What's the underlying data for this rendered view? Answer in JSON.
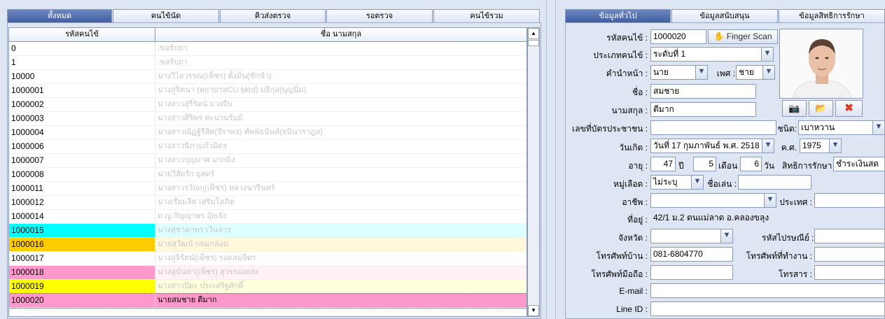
{
  "left_tabs": [
    "ทั้งหมด",
    "คนไข้นัด",
    "คิวส่งตรวจ",
    "รอตรวจ",
    "คนไข้รวม"
  ],
  "right_tabs": [
    "ข้อมูลทั่วไป",
    "ข้อมูลสนับสนุน",
    "ข้อมูลสิทธิการรักษา"
  ],
  "table": {
    "headers": [
      "รหัสคนไข้",
      "ชื่อ นามสกุล"
    ],
    "rows": [
      {
        "id": "0",
        "name": ".ขอรับยา",
        "color": ""
      },
      {
        "id": "1",
        "name": ".ขอรับยา",
        "color": ""
      },
      {
        "id": "10000",
        "name": "นางวิไลวรรณ(เพ็ชร) ตั้งมั่น(ชักนำ)",
        "color": ""
      },
      {
        "id": "1000001",
        "name": "นางสุจิตนา (พยาบาลCU Med) มธิกุล(บุญนิ่ม)",
        "color": ""
      },
      {
        "id": "1000002",
        "name": "นางสาวสุรีรัตน์ ม่วงจีบ",
        "color": ""
      },
      {
        "id": "1000003",
        "name": "นางสาวศิริพร ทะนวนรัมย์",
        "color": ""
      },
      {
        "id": "1000004",
        "name": "นางสาวณัฏฐ์รีสิต(จีราพร) ทัพพ์ธนันท์(ธนินาราฎล)",
        "color": ""
      },
      {
        "id": "1000006",
        "name": "นางสาวนิภาแก้วมิตร",
        "color": ""
      },
      {
        "id": "1000007",
        "name": "นางสาวบุญมาศ มากมิ่ง",
        "color": ""
      },
      {
        "id": "1000008",
        "name": "นายวิสัยรัก ยุสตร์",
        "color": ""
      },
      {
        "id": "1000011",
        "name": "นางสาวรวัณกุ(เพ็ชร) หลวงนารินทร์",
        "color": ""
      },
      {
        "id": "1000012",
        "name": "นางเรียมจิต เสริมโสภิต",
        "color": ""
      },
      {
        "id": "1000014",
        "name": "ด.ญ.กัญญาพร อุ้ยเร้ง",
        "color": ""
      },
      {
        "id": "1000015",
        "name": "นางสุชาดาพร เวินจาร",
        "color": "#00ffff"
      },
      {
        "id": "1000016",
        "name": "นายสุวัฒน์ กลมกล่อม",
        "color": "#ffcc00"
      },
      {
        "id": "1000017",
        "name": "นางสุจิรัตน์(เพ็ชร) รอดสมจิตร",
        "color": ""
      },
      {
        "id": "1000018",
        "name": "นางสุนันทา(เพ็ชร) สุวรรณพงษ",
        "color": "#ff99cc"
      },
      {
        "id": "1000019",
        "name": "นางสาวปิยะ ประเสริฐศักดิ์",
        "color": "#ffff00"
      },
      {
        "id": "1000020",
        "name": "นายสมชาย ตีมาก",
        "color": "#ff99cc",
        "selected": true
      }
    ]
  },
  "form": {
    "hn_label": "รหัสคนไข้ :",
    "hn": "1000020",
    "finger_label": "Finger Scan",
    "type_label": "ประเภทคนไข้ :",
    "type": "ระดับที่ 1",
    "prefix_label": "คำนำหน้า :",
    "prefix": "นาย",
    "sex_label": "เพศ :",
    "sex": "ชาย",
    "fname_label": "ชื่อ :",
    "fname": "สมชาย",
    "lname_label": "นามสกุล :",
    "lname": "ตีมาก",
    "cid_label": "เลขที่บัตรประชาชน :",
    "cid": "",
    "ctype_label": "ชนิด:",
    "ctype": "เบาหวาน",
    "dob_label": "วันเกิด :",
    "dob": "วันที่ 17 กุมภาพันธ์ พ.ศ.  2518",
    "ce_label": "ค.ศ.",
    "ce": "1975",
    "age_label": "อายุ :",
    "age_y": "47",
    "y_unit": "ปี",
    "age_m": "5",
    "m_unit": "เดือน",
    "age_d": "6",
    "d_unit": "วัน",
    "right_label": "สิทธิการรักษา :",
    "right": "ชำระเงินสด",
    "blood_label": "หมู่เลือด :",
    "blood": "ไม่ระบุ",
    "nick_label": "ชื่อเล่น :",
    "nick": "",
    "job_label": "อาชีพ :",
    "job": "",
    "country_label": "ประเทศ :",
    "country": "",
    "addr_label": "ที่อยู่ :",
    "addr": "42/1  ม.2 ตนแม่ลาด อ.คลองขลุง",
    "prov_label": "จังหวัด :",
    "prov": "",
    "zip_label": "รหัสไปรษณีย์ :",
    "zip": "",
    "tel_label": "โทรศัพท์บ้าน :",
    "tel": "081-6804770",
    "wtel_label": "โทรศัพท์ที่ทำงาน :",
    "wtel": "",
    "mob_label": "โทรศัพท์มือถือ :",
    "mob": "",
    "fax_label": "โทรสาร :",
    "fax": "",
    "email_label": "E-mail :",
    "email": "",
    "line_label": "Line ID :",
    "line": ""
  }
}
